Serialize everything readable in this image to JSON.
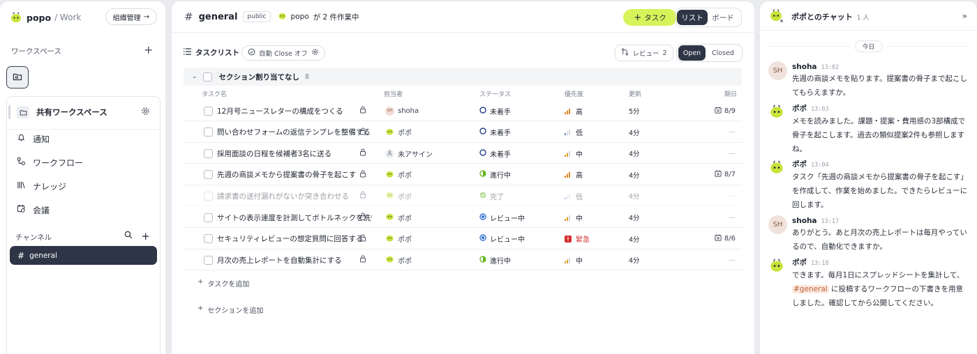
{
  "sidebar": {
    "brand": "popo",
    "brand_sub": "/ Work",
    "org_button": "組織管理",
    "workspace_label": "ワークスペース",
    "workspace_name": "共有ワークスペース",
    "nav": [
      "通知",
      "ワークフロー",
      "ナレッジ",
      "会議"
    ],
    "channels_label": "チャンネル",
    "active_channel": "general"
  },
  "header": {
    "channel": "general",
    "visibility": "public",
    "status_user": "popo",
    "status_text": "が 2 件作業中",
    "task_button": "タスク",
    "views": [
      "リスト",
      "ボード"
    ],
    "active_view": "リスト"
  },
  "toolbar": {
    "list_label": "タスクリスト",
    "auto_close": "自動 Close オフ",
    "review_label": "レビュー",
    "review_count": "2",
    "filters": [
      "Open",
      "Closed"
    ],
    "active_filter": "Open"
  },
  "section": {
    "name": "セクション割り当てなし",
    "count": "8"
  },
  "columns": {
    "task": "タスク名",
    "assignee": "担当者",
    "status": "ステータス",
    "priority": "優先度",
    "updated": "更新",
    "due": "期日"
  },
  "tasks": [
    {
      "title": "12月号ニュースレターの構成をつくる",
      "assignee": "shoha",
      "status": "未着手",
      "priority": "高",
      "updated": "5分",
      "due": "8/9"
    },
    {
      "title": "問い合わせフォームの返信テンプレを整備する",
      "assignee": "ポポ",
      "status": "未着手",
      "priority": "低",
      "updated": "4分",
      "due": "—"
    },
    {
      "title": "採用面談の日程を候補者3名に送る",
      "assignee": "未アサイン",
      "status": "未着手",
      "priority": "中",
      "updated": "4分",
      "due": "—"
    },
    {
      "title": "先週の商談メモから提案書の骨子を起こす",
      "assignee": "ポポ",
      "status": "進行中",
      "priority": "高",
      "updated": "4分",
      "due": "8/7"
    },
    {
      "title": "請求書の送付漏れがないか突き合わせる",
      "assignee": "ポポ",
      "status": "完了",
      "priority": "低",
      "updated": "4分",
      "due": "—"
    },
    {
      "title": "サイトの表示速度を計測してボトルネックを洗い出す",
      "assignee": "ポポ",
      "status": "レビュー中",
      "priority": "中",
      "updated": "4分",
      "due": "—"
    },
    {
      "title": "セキュリティレビューの想定質問に回答する",
      "assignee": "ポポ",
      "status": "レビュー中",
      "priority": "緊急",
      "updated": "4分",
      "due": "8/6"
    },
    {
      "title": "月次の売上レポートを自動集計にする",
      "assignee": "ポポ",
      "status": "進行中",
      "priority": "中",
      "updated": "4分",
      "due": "—"
    }
  ],
  "add_task": "タスクを追加",
  "add_section": "セクションを追加",
  "chat": {
    "title": "ポポとのチャット",
    "members": "1 人",
    "day": "今日",
    "messages": [
      {
        "name": "shoha",
        "initials": "SH",
        "time": "13:02",
        "text": "先週の商談メモを貼ります。提案書の骨子まで起こしてもらえますか。"
      },
      {
        "name": "ポポ",
        "time": "13:03",
        "text": "メモを読みました。課題・提案・費用感の3部構成で骨子を起こします。過去の類似提案2件も参照しますね。"
      },
      {
        "name": "ポポ",
        "time": "13:04",
        "text": "タスク「先週の商談メモから提案書の骨子を起こす」を作成して、作業を始めました。できたらレビューに回します。"
      },
      {
        "name": "shoha",
        "initials": "SH",
        "time": "13:17",
        "text": "ありがとう。あと月次の売上レポートは毎月やっているので、自動化できますか。"
      },
      {
        "name": "ポポ",
        "time": "13:18",
        "text_before": "できます。毎月1日にスプレッドシートを集計して、",
        "mention": "#general",
        "text_after": " に投稿するワークフローの下書きを用意しました。確認してから公開してください。"
      }
    ]
  },
  "colors": {
    "accent": "#d8f35a",
    "dark": "#2e3546",
    "status_todo": "#1f3f8a",
    "status_progress": "#6bb82a",
    "status_done": "#6bb82a",
    "status_review": "#2f6fd1",
    "priority_high": "#e0892b",
    "priority_low": "#6a88c9",
    "priority_mid": "#e0a22b",
    "priority_urgent": "#d32f2f"
  }
}
